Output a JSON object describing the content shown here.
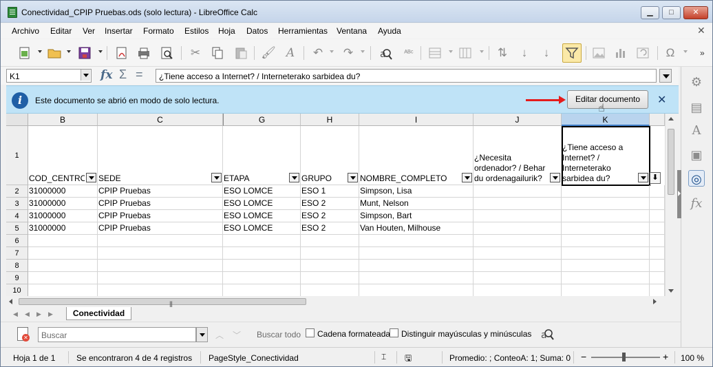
{
  "window": {
    "title": "Conectividad_CPIP Pruebas.ods (solo lectura) - LibreOffice Calc"
  },
  "menu": [
    "Archivo",
    "Editar",
    "Ver",
    "Insertar",
    "Formato",
    "Estilos",
    "Hoja",
    "Datos",
    "Herramientas",
    "Ventana",
    "Ayuda"
  ],
  "formula_bar": {
    "name_box": "K1",
    "content": "¿Tiene acceso a Internet? / Interneterako sarbidea du?"
  },
  "infobar": {
    "message": "Este documento se abrió en modo de solo lectura.",
    "edit_button": "Editar documento"
  },
  "grid": {
    "columns": [
      "B",
      "C",
      "G",
      "H",
      "I",
      "J",
      "K"
    ],
    "header_row_num": "1",
    "headers": [
      "COD_CENTRO",
      "SEDE",
      "ETAPA",
      "GRUPO",
      "NOMBRE_COMPLETO",
      "¿Necesita ordenador? / Behar du ordenagailurik?",
      "¿Tiene acceso a Internet? / Interneterako sarbidea du?"
    ],
    "rows": [
      {
        "num": "2",
        "cells": [
          "31000000",
          "CPIP Pruebas",
          "ESO LOMCE",
          "ESO 1",
          "Simpson, Lisa",
          "",
          ""
        ]
      },
      {
        "num": "3",
        "cells": [
          "31000000",
          "CPIP Pruebas",
          "ESO LOMCE",
          "ESO 2",
          "Munt, Nelson",
          "",
          ""
        ]
      },
      {
        "num": "4",
        "cells": [
          "31000000",
          "CPIP Pruebas",
          "ESO LOMCE",
          "ESO 2",
          "Simpson, Bart",
          "",
          ""
        ]
      },
      {
        "num": "5",
        "cells": [
          "31000000",
          "CPIP Pruebas",
          "ESO LOMCE",
          "ESO 2",
          "Van Houten, Milhouse",
          "",
          ""
        ]
      },
      {
        "num": "6",
        "cells": [
          "",
          "",
          "",
          "",
          "",
          "",
          ""
        ]
      },
      {
        "num": "7",
        "cells": [
          "",
          "",
          "",
          "",
          "",
          "",
          ""
        ]
      },
      {
        "num": "8",
        "cells": [
          "",
          "",
          "",
          "",
          "",
          "",
          ""
        ]
      },
      {
        "num": "9",
        "cells": [
          "",
          "",
          "",
          "",
          "",
          "",
          ""
        ]
      },
      {
        "num": "10",
        "cells": [
          "",
          "",
          "",
          "",
          "",
          "",
          ""
        ]
      }
    ]
  },
  "sheet_tab": "Conectividad",
  "find_toolbar": {
    "placeholder": "Buscar",
    "find_all": "Buscar todo",
    "formatted_label": "Cadena formateada",
    "match_case_label": "Distinguir mayúsculas y minúsculas"
  },
  "status": {
    "sheet": "Hoja 1 de 1",
    "found": "Se encontraron 4 de 4 registros",
    "page_style": "PageStyle_Conectividad",
    "summary": "Promedio: ; ConteoA: 1; Suma: 0",
    "zoom": "100 %"
  }
}
